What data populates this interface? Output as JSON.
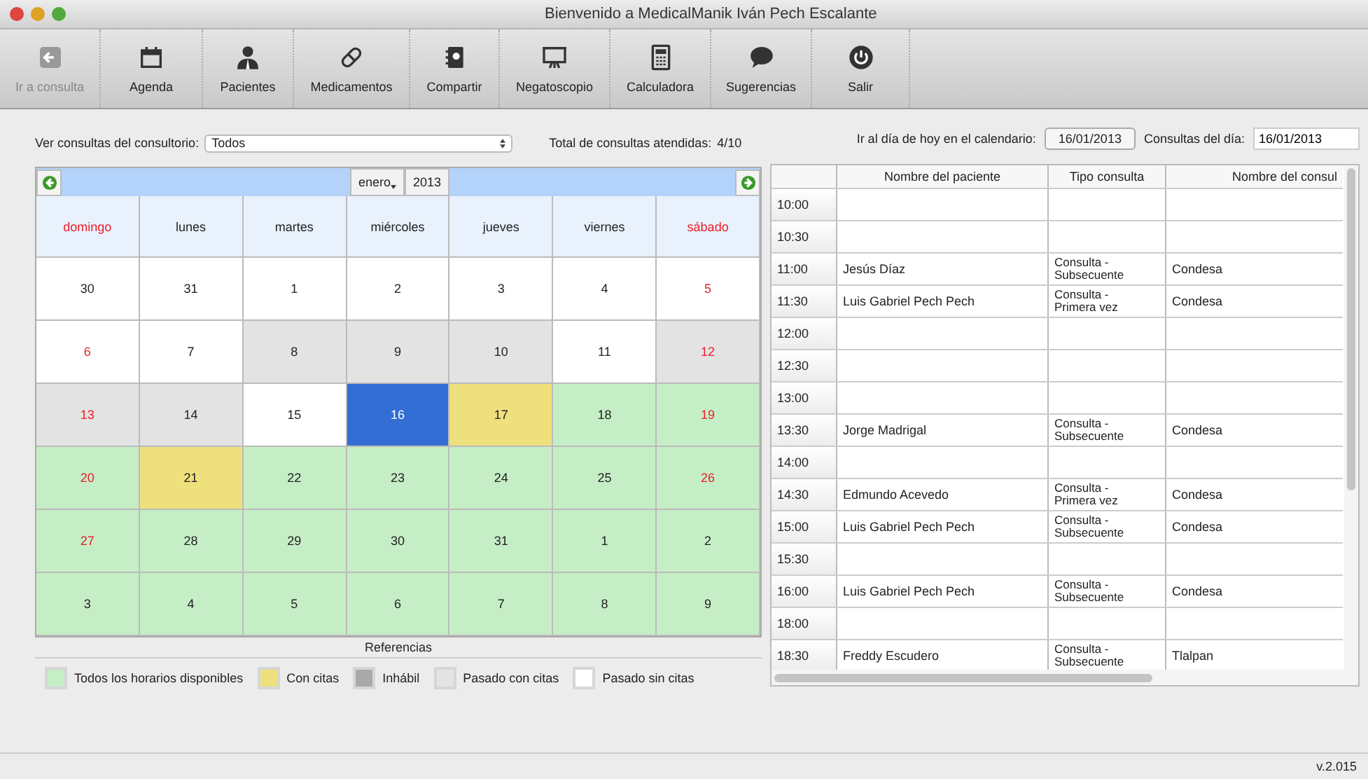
{
  "window": {
    "title": "Bienvenido a MedicalManik  Iván Pech Escalante"
  },
  "toolbar": [
    {
      "label": "Ir a consulta",
      "disabled": true
    },
    {
      "label": "Agenda",
      "disabled": false
    },
    {
      "label": "Pacientes",
      "disabled": false
    },
    {
      "label": "Medicamentos",
      "disabled": false
    },
    {
      "label": "Compartir",
      "disabled": false
    },
    {
      "label": "Negatoscopio",
      "disabled": false
    },
    {
      "label": "Calculadora",
      "disabled": false
    },
    {
      "label": "Sugerencias",
      "disabled": false
    },
    {
      "label": "Salir",
      "disabled": false
    }
  ],
  "filter": {
    "label": "Ver consultas del consultorio:",
    "value": "Todos"
  },
  "total": {
    "label": "Total de consultas atendidas:",
    "value": "4/10"
  },
  "today": {
    "label": "Ir al día de hoy en el calendario:",
    "button": "16/01/2013"
  },
  "day_field": {
    "label": "Consultas del día:",
    "value": "16/01/2013"
  },
  "calendar": {
    "month": "enero",
    "year": "2013",
    "weekdays": [
      "domingo",
      "lunes",
      "martes",
      "miércoles",
      "jueves",
      "viernes",
      "sábado"
    ],
    "weeks": [
      [
        {
          "day": "30",
          "kind": "past",
          "weekend": false
        },
        {
          "day": "31",
          "kind": "past",
          "weekend": false
        },
        {
          "day": "1",
          "kind": "past",
          "weekend": false
        },
        {
          "day": "2",
          "kind": "past",
          "weekend": false
        },
        {
          "day": "3",
          "kind": "past",
          "weekend": false
        },
        {
          "day": "4",
          "kind": "past",
          "weekend": false
        },
        {
          "day": "5",
          "kind": "past",
          "weekend": true
        }
      ],
      [
        {
          "day": "6",
          "kind": "past",
          "weekend": true
        },
        {
          "day": "7",
          "kind": "past",
          "weekend": false
        },
        {
          "day": "8",
          "kind": "past_booked",
          "weekend": false
        },
        {
          "day": "9",
          "kind": "past_booked",
          "weekend": false
        },
        {
          "day": "10",
          "kind": "past_booked",
          "weekend": false
        },
        {
          "day": "11",
          "kind": "past",
          "weekend": false
        },
        {
          "day": "12",
          "kind": "past_booked",
          "weekend": true
        }
      ],
      [
        {
          "day": "13",
          "kind": "past_booked",
          "weekend": true
        },
        {
          "day": "14",
          "kind": "past_booked",
          "weekend": false
        },
        {
          "day": "15",
          "kind": "past",
          "weekend": false
        },
        {
          "day": "16",
          "kind": "today",
          "weekend": false
        },
        {
          "day": "17",
          "kind": "booked",
          "weekend": false
        },
        {
          "day": "18",
          "kind": "available",
          "weekend": false
        },
        {
          "day": "19",
          "kind": "available",
          "weekend": true
        }
      ],
      [
        {
          "day": "20",
          "kind": "available",
          "weekend": true
        },
        {
          "day": "21",
          "kind": "booked",
          "weekend": false
        },
        {
          "day": "22",
          "kind": "available",
          "weekend": false
        },
        {
          "day": "23",
          "kind": "available",
          "weekend": false
        },
        {
          "day": "24",
          "kind": "available",
          "weekend": false
        },
        {
          "day": "25",
          "kind": "available",
          "weekend": false
        },
        {
          "day": "26",
          "kind": "available",
          "weekend": true
        }
      ],
      [
        {
          "day": "27",
          "kind": "available",
          "weekend": true
        },
        {
          "day": "28",
          "kind": "available",
          "weekend": false
        },
        {
          "day": "29",
          "kind": "available",
          "weekend": false
        },
        {
          "day": "30",
          "kind": "available",
          "weekend": false
        },
        {
          "day": "31",
          "kind": "available",
          "weekend": false
        },
        {
          "day": "1",
          "kind": "available",
          "weekend": false
        },
        {
          "day": "2",
          "kind": "available",
          "weekend": false
        }
      ],
      [
        {
          "day": "3",
          "kind": "available",
          "weekend": false
        },
        {
          "day": "4",
          "kind": "available",
          "weekend": false
        },
        {
          "day": "5",
          "kind": "available",
          "weekend": false
        },
        {
          "day": "6",
          "kind": "available",
          "weekend": false
        },
        {
          "day": "7",
          "kind": "available",
          "weekend": false
        },
        {
          "day": "8",
          "kind": "available",
          "weekend": false
        },
        {
          "day": "9",
          "kind": "available",
          "weekend": false
        }
      ]
    ]
  },
  "legend": {
    "title": "Referencias",
    "items": [
      {
        "label": "Todos los horarios disponibles",
        "kind": "available"
      },
      {
        "label": "Con citas",
        "kind": "booked"
      },
      {
        "label": "Inhábil",
        "kind": "closed"
      },
      {
        "label": "Pasado con citas",
        "kind": "past_booked"
      },
      {
        "label": "Pasado sin citas",
        "kind": "past"
      }
    ]
  },
  "schedule": {
    "columns": [
      "Nombre del paciente",
      "Tipo consulta",
      "Nombre del consul"
    ],
    "rows": [
      {
        "time": "10:00"
      },
      {
        "time": "10:30"
      },
      {
        "time": "11:00",
        "patient": "Jesús Díaz",
        "type": "Consulta - Subsecuente",
        "office": "Condesa"
      },
      {
        "time": "11:30",
        "patient": "Luis Gabriel Pech Pech",
        "type": "Consulta - Primera vez",
        "office": "Condesa"
      },
      {
        "time": "12:00"
      },
      {
        "time": "12:30"
      },
      {
        "time": "13:00"
      },
      {
        "time": "13:30",
        "patient": "Jorge Madrigal",
        "type": "Consulta - Subsecuente",
        "office": "Condesa"
      },
      {
        "time": "14:00"
      },
      {
        "time": "14:30",
        "patient": "Edmundo Acevedo",
        "type": "Consulta - Primera vez",
        "office": "Condesa"
      },
      {
        "time": "15:00",
        "patient": "Luis Gabriel Pech Pech",
        "type": "Consulta - Subsecuente",
        "office": "Condesa"
      },
      {
        "time": "15:30"
      },
      {
        "time": "16:00",
        "patient": "Luis Gabriel Pech Pech",
        "type": "Consulta - Subsecuente",
        "office": "Condesa"
      },
      {
        "time": "18:00"
      },
      {
        "time": "18:30",
        "patient": "Freddy Escudero",
        "type": "Consulta - Subsecuente",
        "office": "Tlalpan"
      }
    ]
  },
  "status_bar": {
    "version": "v.2.015"
  }
}
